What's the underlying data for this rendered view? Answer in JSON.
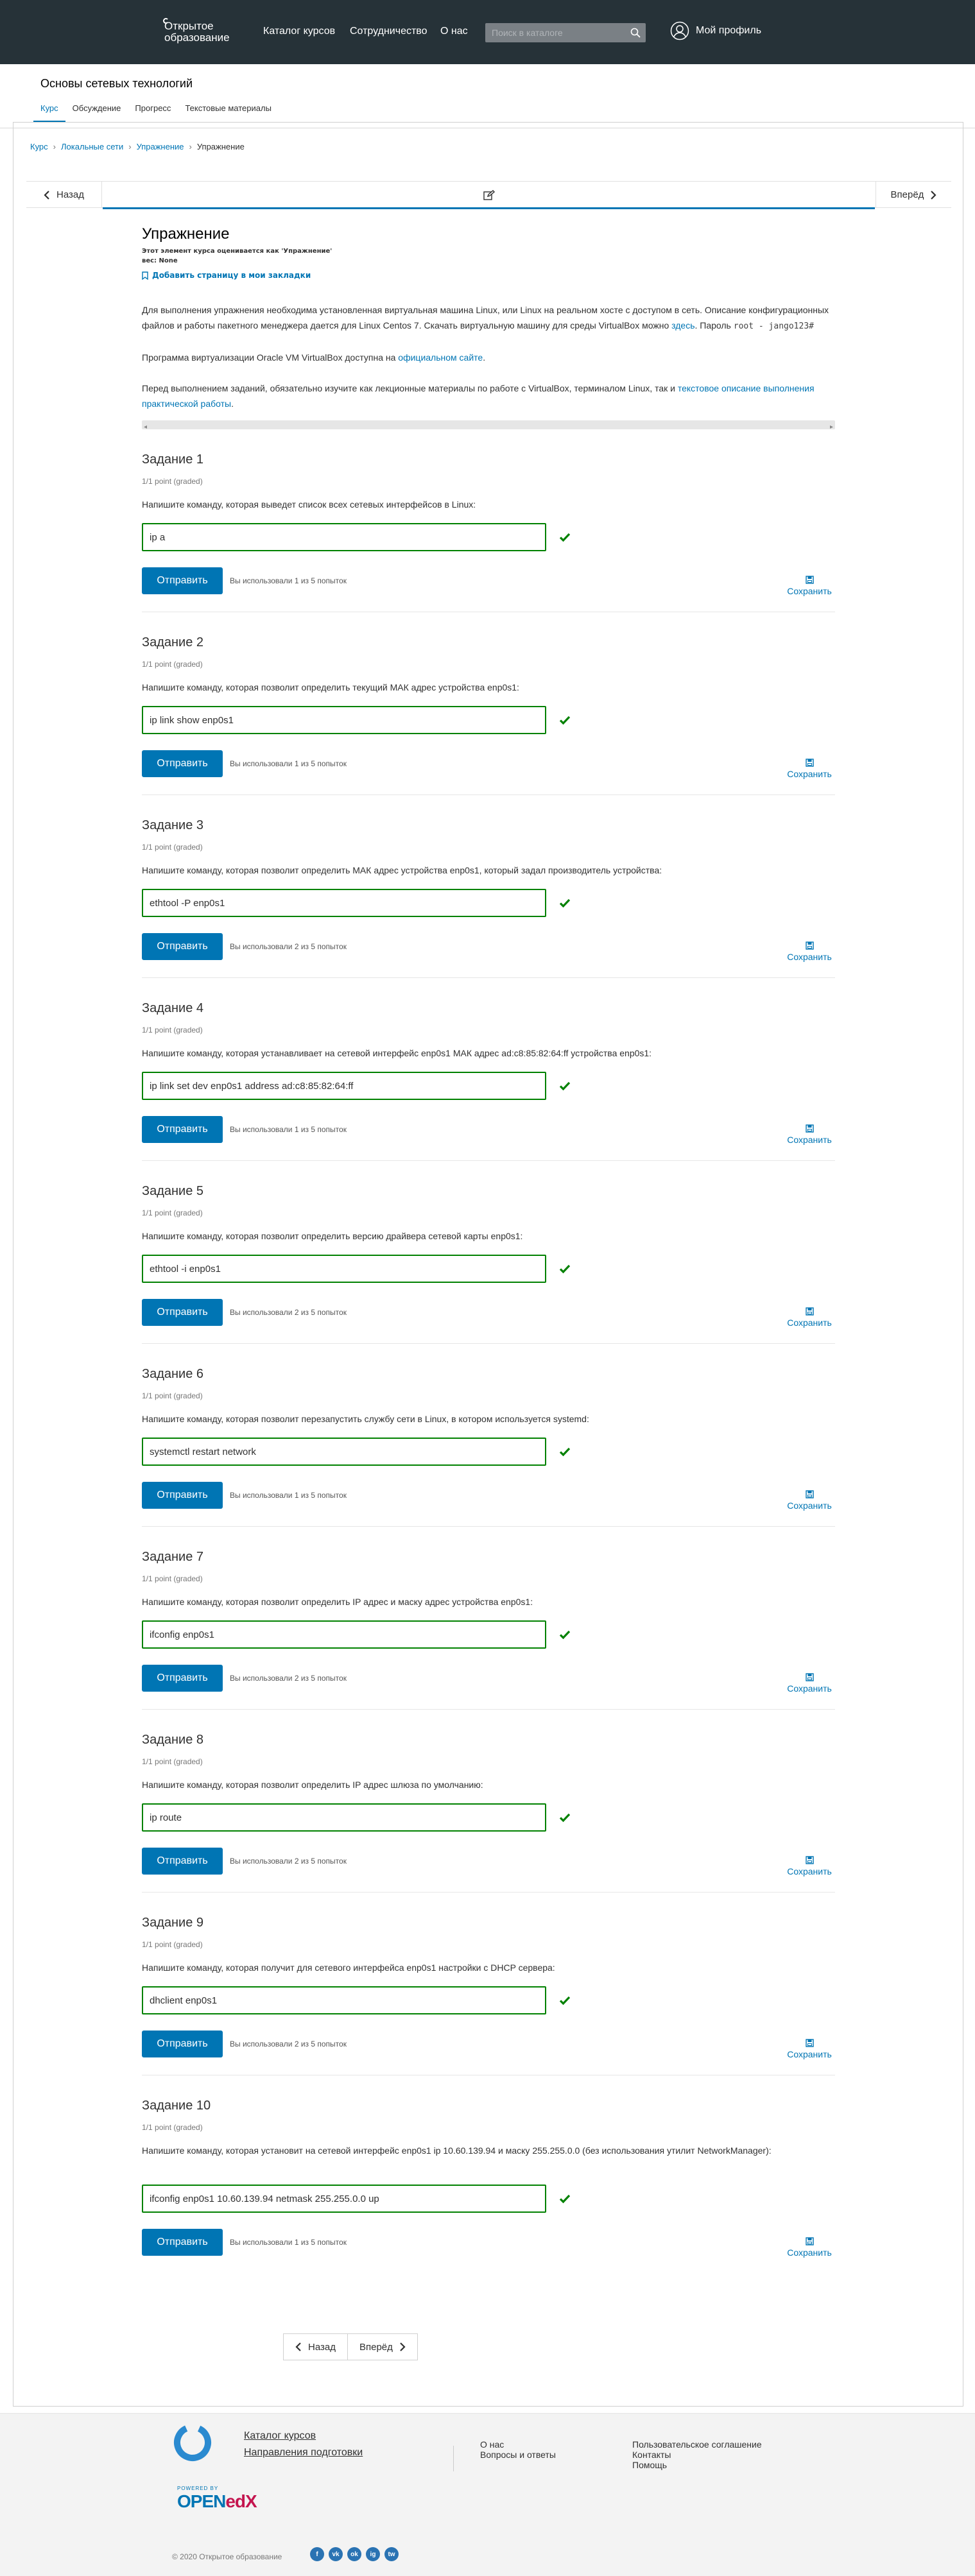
{
  "header": {
    "logo_line1": "Открытое",
    "logo_line2": "образование",
    "nav": [
      "Каталог курсов",
      "Сотрудничество",
      "О нас"
    ],
    "search_placeholder": "Поиск в каталоге",
    "profile": "Мой профиль"
  },
  "course": {
    "title": "Основы сетевых технологий",
    "tabs": [
      "Курс",
      "Обсуждение",
      "Прогресс",
      "Текстовые материалы"
    ]
  },
  "breadcrumb": [
    "Курс",
    "Локальные сети",
    "Упражнение",
    "Упражнение"
  ],
  "seq": {
    "prev": "Назад",
    "next": "Вперёд"
  },
  "unit": {
    "title": "Упражнение",
    "meta1": "Этот элемент курса оценивается как 'Упражнение'",
    "meta2": "вес: None",
    "bookmark": "Добавить страницу в мои закладки",
    "p1a": "Для выполнения упражнения необходима установленная виртуальная машина Linux, или Linux на реальном хосте с доступом в сеть. Описание конфигурационных файлов и работы пакетного менеджера дается для Linux Centos 7. Скачать виртуальную машину для среды VirtualBox можно ",
    "p1link": "здесь",
    "p1b": ". Пароль ",
    "p1code": "root - jango123#",
    "p2a": "Программа виртуализации Oracle VM VirtualBox доступна на ",
    "p2link": "официальном сайте",
    "p2b": ".",
    "p3a": "Перед выполнением заданий, обязательно изучите как лекционные материалы по работе с VirtualBox, терминалом Linux, так и ",
    "p3link": "текстовое описание выполнения практической работы",
    "p3b": "."
  },
  "labels": {
    "points": "1/1 point (graded)",
    "submit": "Отправить",
    "save": "Сохранить"
  },
  "problems": [
    {
      "title": "Задание 1",
      "question": "Напишите команду, которая выведет список всех сетевых интерфейсов в Linux:",
      "answer": "ip a",
      "attempts": "Вы использовали 1 из 5 попыток"
    },
    {
      "title": "Задание 2",
      "question": "Напишите команду, которая позволит определить текущий МАК адрес устройства enp0s1:",
      "answer": "ip link show enp0s1",
      "attempts": "Вы использовали 1 из 5 попыток"
    },
    {
      "title": "Задание 3",
      "question": "Напишите команду, которая позволит определить МАК адрес устройства enp0s1, который задал производитель устройства:",
      "answer": "ethtool -P enp0s1",
      "attempts": "Вы использовали 2 из 5 попыток"
    },
    {
      "title": "Задание 4",
      "question": "Напишите команду, которая устанавливает на сетевой интерфейс enp0s1 МАК адрес ad:c8:85:82:64:ff устройства enp0s1:",
      "answer": "ip link set dev enp0s1 address ad:c8:85:82:64:ff",
      "attempts": "Вы использовали 1 из 5 попыток"
    },
    {
      "title": "Задание 5",
      "question": "Напишите команду, которая позволит определить версию драйвера сетевой карты enp0s1:",
      "answer": "ethtool -i enp0s1",
      "attempts": "Вы использовали 2 из 5 попыток"
    },
    {
      "title": "Задание 6",
      "question": "Напишите команду, которая позволит перезапустить службу сети в Linux, в котором используется systemd:",
      "answer": "systemctl restart network",
      "attempts": "Вы использовали 1 из 5 попыток"
    },
    {
      "title": "Задание 7",
      "question": "Напишите команду, которая позволит определить IP адрес и маску адрес устройства enp0s1:",
      "answer": "ifconfig enp0s1",
      "attempts": "Вы использовали 2 из 5 попыток"
    },
    {
      "title": "Задание 8",
      "question": "Напишите команду, которая позволит определить IP адрес шлюза по умолчанию:",
      "answer": "ip route",
      "attempts": "Вы использовали 2 из 5 попыток"
    },
    {
      "title": "Задание 9",
      "question": "Напишите команду, которая получит для сетевого интерфейса enp0s1 настройки с DHCP сервера:",
      "answer": "dhclient enp0s1",
      "attempts": "Вы использовали 2 из 5 попыток"
    },
    {
      "title": "Задание 10",
      "question": "Напишите команду, которая установит на сетевой интерфейс enp0s1 ip 10.60.139.94 и маску 255.255.0.0 (без использования утилит NetworkManager):",
      "answer": "ifconfig enp0s1 10.60.139.94 netmask 255.255.0.0 up",
      "attempts": "Вы использовали 1 из 5 попыток"
    }
  ],
  "footer": {
    "links1": [
      "Каталог курсов",
      "Направления подготовки"
    ],
    "links2": [
      "О нас",
      "Вопросы и ответы"
    ],
    "links3": [
      "Пользовательское соглашение",
      "Контакты",
      "Помощь"
    ],
    "powered": "POWERED BY",
    "openedx_a": "OPEN",
    "openedx_b": "edX",
    "copyright": "© 2020 Открытое образование",
    "social": [
      "f",
      "vk",
      "ok",
      "ig",
      "tw"
    ]
  },
  "colors": {
    "accent": "#0075b4",
    "topbar": "#263238",
    "correct": "#008100"
  }
}
